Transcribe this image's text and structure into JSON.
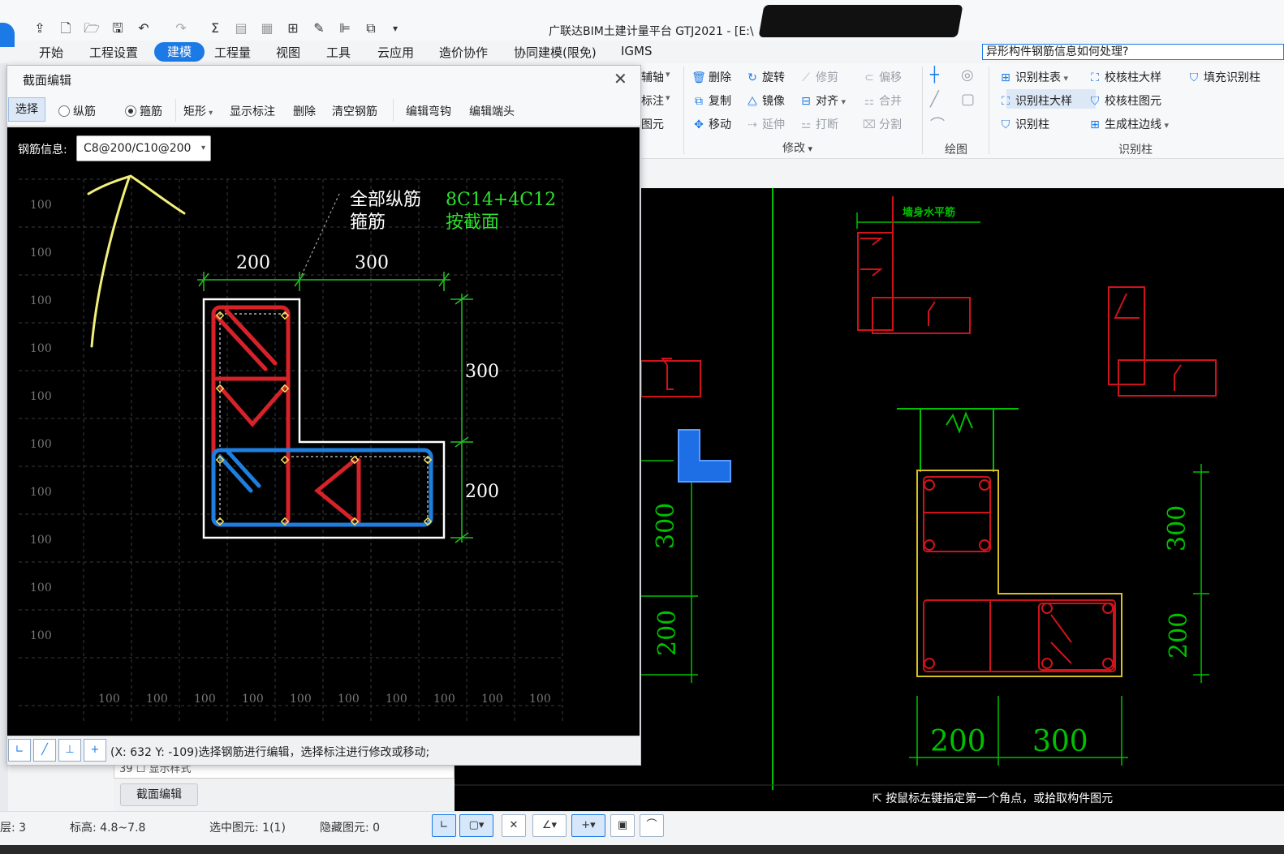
{
  "app": {
    "title": "广联达BIM土建计量平台 GTJ2021 - [E:\\",
    "help_search": "异形构件钢筋信息如何处理?"
  },
  "menu": [
    "开始",
    "工程设置",
    "建模",
    "工程量",
    "视图",
    "工具",
    "云应用",
    "造价协作",
    "协同建模(限免)",
    "IGMS"
  ],
  "ribbon": {
    "left_partial": [
      "辅轴",
      "标注",
      "图元"
    ],
    "modify": {
      "items": [
        "删除",
        "旋转",
        "修剪",
        "偏移",
        "复制",
        "镜像",
        "对齐",
        "合并",
        "移动",
        "延伸",
        "打断",
        "分割"
      ],
      "group_label": "修改"
    },
    "draw": {
      "group_label": "绘图"
    },
    "identify_column": {
      "items": [
        "识别柱表",
        "校核柱大样",
        "填充识别柱",
        "识别柱大样",
        "校核柱图元",
        "识别柱",
        "生成柱边线"
      ],
      "group_label": "识别柱"
    }
  },
  "dialog": {
    "title": "截面编辑",
    "toolbar": {
      "select": "选择",
      "longitudinal": "纵筋",
      "stirrup": "箍筋",
      "shape": "矩形",
      "show_dims": "显示标注",
      "delete": "删除",
      "clear_rebar": "清空钢筋",
      "edit_hook": "编辑弯钩",
      "edit_end": "编辑端头"
    },
    "rebar_info_label": "钢筋信息:",
    "rebar_info_value": "C8@200/C10@200",
    "canvas": {
      "grid_label": "100",
      "text_all_long": "全部纵筋",
      "text_stirrup": "箍筋",
      "value_long": "8C14+4C12",
      "value_stirrup": "按截面",
      "dim_200": "200",
      "dim_300": "300"
    },
    "status": "(X: 632 Y: -109)选择钢筋进行编辑，选择标注进行修改或移动;"
  },
  "main_canvas": {
    "dim_200": "200",
    "dim_300": "300",
    "detail_label": "墙身水平筋",
    "status_hint": "按鼠标左键指定第一个角点，或拾取构件图元"
  },
  "property_panel": {
    "row_text": "39  ☐ 显示样式",
    "section_edit_button": "截面编辑"
  },
  "statusbar": {
    "layer": "层: 3",
    "elevation": "标高: 4.8~7.8",
    "selected": "选中图元: 1(1)",
    "hidden": "隐藏图元: 0"
  },
  "colors": {
    "accent": "#1b7ae6",
    "rebar_red": "#d8222a",
    "rebar_blue": "#1e7fe0",
    "cad_green": "#00c000",
    "cad_red": "#d0131a",
    "cad_yellow": "#d7c020",
    "annotation_yellow": "#f2ef7a"
  }
}
